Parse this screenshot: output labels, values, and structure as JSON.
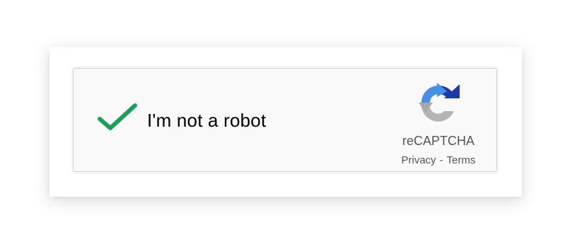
{
  "checkbox": {
    "label": "I'm not a robot",
    "checked": true,
    "check_color": "#1e9e56"
  },
  "brand": {
    "name": "reCAPTCHA",
    "icon": "recaptcha-logo-icon",
    "colors": {
      "blue_light": "#4a90e2",
      "blue_dark": "#1c3aa9",
      "gray": "#aaaaaa"
    }
  },
  "links": {
    "privacy": "Privacy",
    "separator": "-",
    "terms": "Terms"
  }
}
